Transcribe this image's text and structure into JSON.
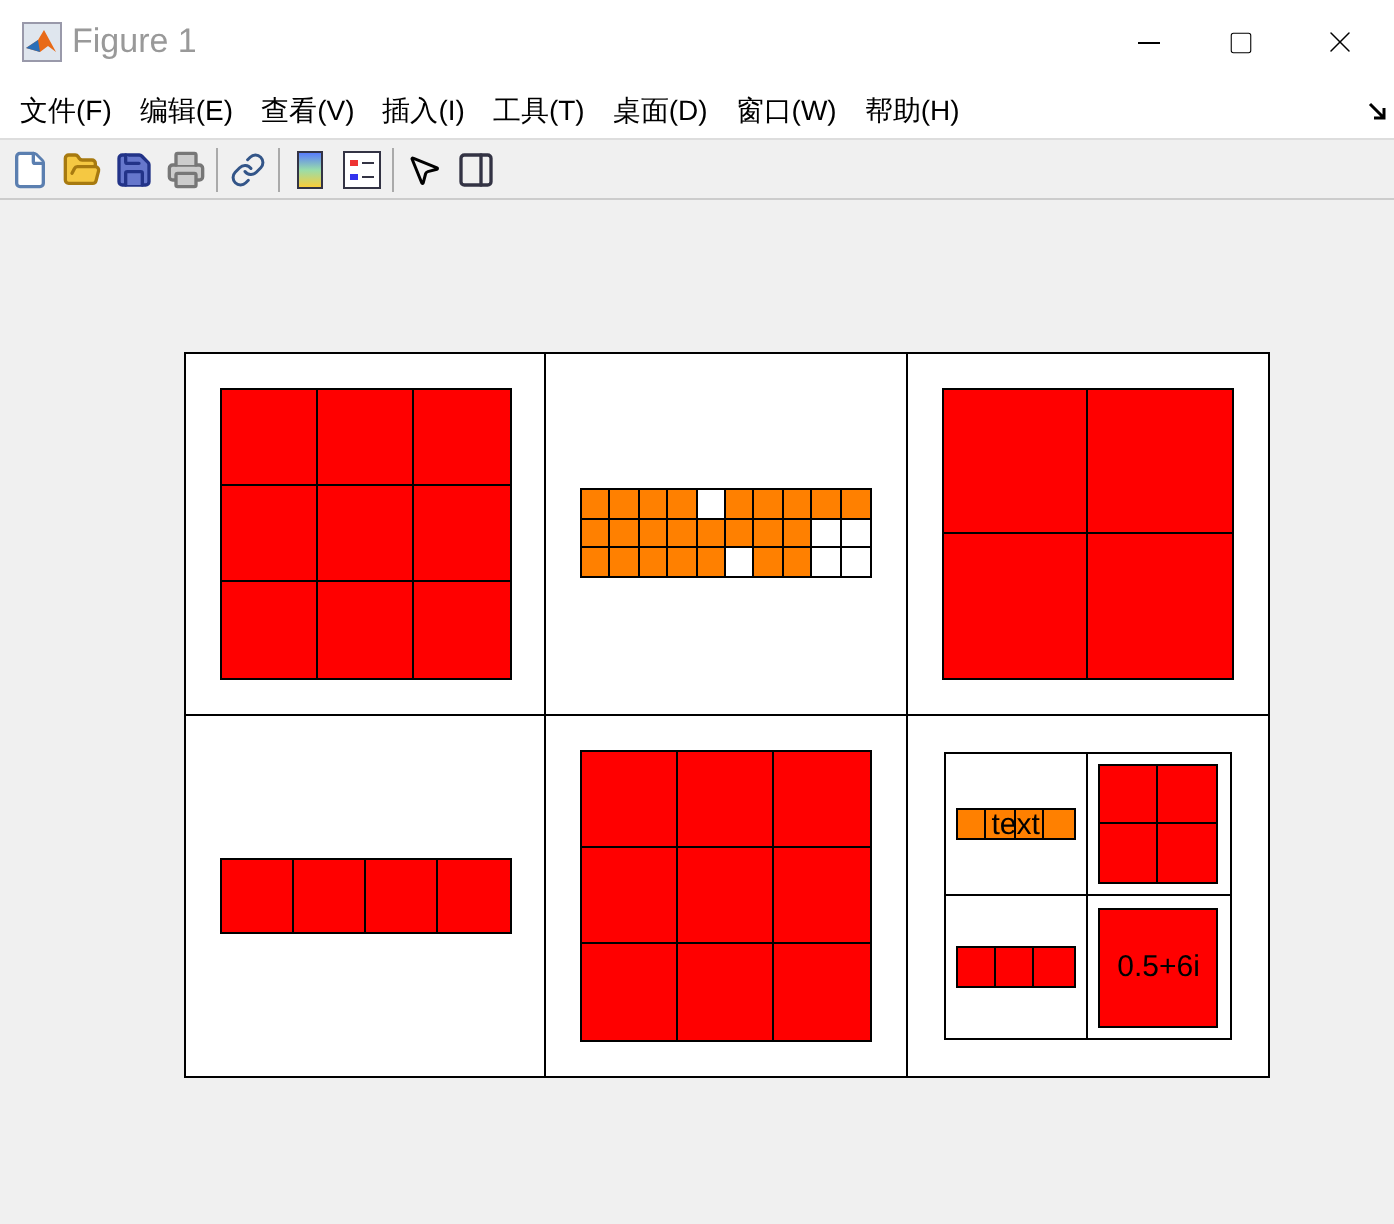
{
  "window": {
    "title": "Figure 1"
  },
  "menu": [
    "文件(F)",
    "编辑(E)",
    "查看(V)",
    "插入(I)",
    "工具(T)",
    "桌面(D)",
    "窗口(W)",
    "帮助(H)"
  ],
  "plot": {
    "cells": [
      {
        "kind": "matrix",
        "color": "#ff0000",
        "grid": [
          [
            true,
            true,
            true
          ],
          [
            true,
            true,
            true
          ],
          [
            true,
            true,
            true
          ]
        ]
      },
      {
        "kind": "matrix",
        "color": "#ff8000",
        "grid": [
          [
            true,
            true,
            true,
            true,
            false,
            true,
            true,
            true,
            true,
            true
          ],
          [
            true,
            true,
            true,
            true,
            true,
            true,
            true,
            true,
            false,
            false
          ],
          [
            true,
            true,
            true,
            true,
            true,
            false,
            true,
            true,
            false,
            false
          ]
        ]
      },
      {
        "kind": "matrix",
        "color": "#ff0000",
        "grid": [
          [
            true,
            true
          ],
          [
            true,
            true
          ]
        ]
      },
      {
        "kind": "matrix",
        "color": "#ff0000",
        "grid": [
          [
            true,
            true,
            true,
            true
          ]
        ]
      },
      {
        "kind": "matrix",
        "color": "#ff0000",
        "grid": [
          [
            true,
            true,
            true
          ],
          [
            true,
            true,
            true
          ],
          [
            true,
            true,
            true
          ]
        ]
      },
      {
        "kind": "cell",
        "children": [
          {
            "kind": "matrix",
            "color": "#ff8000",
            "grid": [
              [
                true,
                true,
                true,
                true
              ]
            ],
            "label": "text"
          },
          {
            "kind": "matrix",
            "color": "#ff0000",
            "grid": [
              [
                true,
                true
              ],
              [
                true,
                true
              ]
            ]
          },
          {
            "kind": "matrix",
            "color": "#ff0000",
            "grid": [
              [
                true,
                true,
                true
              ]
            ]
          },
          {
            "kind": "matrix",
            "color": "#ff0000",
            "grid": [
              [
                true
              ]
            ],
            "label": "0.5+6i"
          }
        ]
      }
    ]
  }
}
